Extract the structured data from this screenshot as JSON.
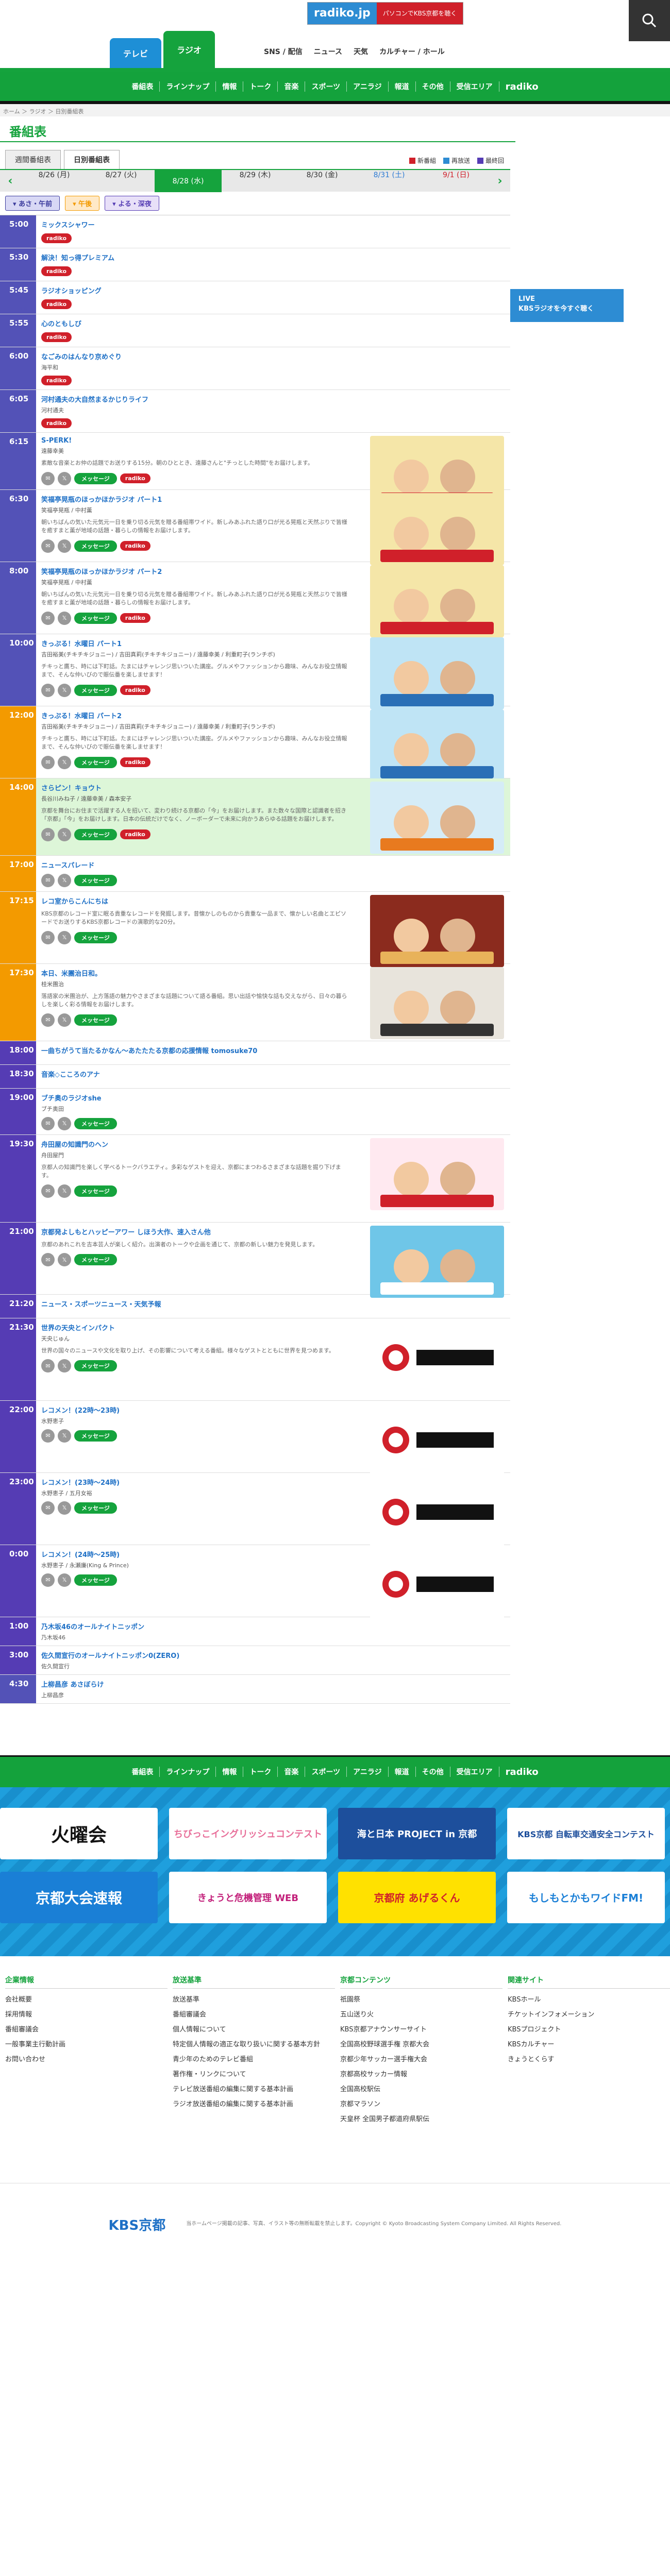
{
  "header": {
    "tab_tv": "テレビ",
    "tab_radio": "ラジオ",
    "radiko_logo": "radiko.jp",
    "radiko_text": "パソコンでKBS京都を聴く",
    "nav": [
      "SNS / 配信",
      "ニュース",
      "天気",
      "カルチャー / ホール"
    ],
    "subnav": [
      "番組表",
      "ラインナップ",
      "情報",
      "トーク",
      "音楽",
      "スポーツ",
      "アニラジ",
      "報道",
      "その他",
      "受信エリア",
      "radiko"
    ],
    "breadcrumb": "ホーム ＞ ラジオ ＞ 日別番組表",
    "title": "番組表"
  },
  "sidebar": {
    "live_label": "LIVE",
    "live_text": "KBSラジオを今すぐ聴く"
  },
  "views": {
    "weekly": "週間番組表",
    "daily": "日別番組表",
    "legend": [
      "新番組",
      "再放送",
      "最終回"
    ]
  },
  "dates": [
    "8/26 (月)",
    "8/27 (火)",
    "8/28 (水)",
    "8/29 (木)",
    "8/30 (金)",
    "8/31 (土)",
    "9/1 (日)"
  ],
  "periods": [
    "あさ・午前",
    "午後",
    "よる・深夜"
  ],
  "buttons": {
    "radiko": "radiko",
    "message": "メッセージ"
  },
  "programs": [
    {
      "time": "5:00",
      "title": "ミックスシャワー",
      "cast": "",
      "desc": ""
    },
    {
      "time": "5:30",
      "title": "解決！知っ得プレミアム",
      "cast": "",
      "desc": ""
    },
    {
      "time": "5:45",
      "title": "ラジオショッピング",
      "cast": "",
      "desc": ""
    },
    {
      "time": "5:55",
      "title": "心のともしび",
      "cast": "",
      "desc": ""
    },
    {
      "time": "6:00",
      "title": "なごみのはんなり京めぐり",
      "cast": "海平和",
      "desc": ""
    },
    {
      "time": "6:05",
      "title": "河村通夫の大自然まるかじりライフ",
      "cast": "河村通夫",
      "desc": ""
    },
    {
      "time": "6:15",
      "title": "S-PERK!",
      "cast": "遠藤幸美",
      "desc": "素敵な音楽とお仲の話題でお送りする15分。朝のひととき、遠藤さんと\"チっとした時間\"をお届けします。"
    },
    {
      "time": "6:30",
      "title": "笑福亭晃瓶のほっかほかラジオ パート1",
      "cast": "笑福亭晃瓶 / 中村薫",
      "desc": "朝いちばんの気いた元気元一日を乗り切る元気を贈る番組帯ワイド。新しみあふれた語り口が光る晃瓶と天然ぶりで皆様を癒すまと薫が地域の話題・暮らしの情報をお届けします。"
    },
    {
      "time": "8:00",
      "title": "笑福亭晃瓶のほっかほかラジオ パート2",
      "cast": "笑福亭晃瓶 / 中村薫",
      "desc": "朝いちばんの気いた元気元一日を乗り切る元気を贈る番組帯ワイド。新しみあふれた語り口が光る晃瓶と天然ぶりで皆様を癒すまと薫が地域の話題・暮らしの情報をお届けします。"
    },
    {
      "time": "10:00",
      "title": "きっぷる！水曜日 パート1",
      "cast": "吉田裕美(チキチキジョニー) / 吉田真莉(チキチキジョニー) / 遠藤幸美 / 利重町子(ランチボ)",
      "desc": "チキっと鷹ち、時には下町話。たまにはチャレンジ思いついた講座。グルメやファッションから趣味、みんなお役立情報まで、そんな仲いびので賑伝番を楽しませます！"
    },
    {
      "time": "12:00",
      "title": "きっぷる！水曜日 パート2",
      "cast": "吉田裕美(チキチキジョニー) / 吉田真莉(チキチキジョニー) / 遠藤幸美 / 利重町子(ランチボ)",
      "desc": "チキっと鷹ち、時には下町話。たまにはチャレンジ思いついた講座。グルメやファッションから趣味、みんなお役立情報まで、そんな仲いびので賑伝番を楽しませます！"
    },
    {
      "time": "14:00",
      "title": "さらピン！キョウト",
      "cast": "長谷川みね子 / 遠藤幸美 / 森本安子",
      "desc": "京都を舞台にお住まで活躍する人を招いて、変わり続ける京都の「今」をお届けします。また数々な国際と認識者を招き「京都」「今」をお届けします。日本の伝統だけでなく、ノーボーダーで未来に向かうあらゆる話題をお届けします。"
    },
    {
      "time": "17:00",
      "title": "ニュースパレード",
      "cast": "",
      "desc": ""
    },
    {
      "time": "17:15",
      "title": "レコ室からこんにちは",
      "cast": "",
      "desc": "KBS京都のレコード室に眠る貴重なレコードを発掘します。昔懐かしのものから貴重な一品まで、懐かしい名曲とエピソードでお送りするKBS京都レコードの演歌的な20分。"
    },
    {
      "time": "17:30",
      "title": "本日、米團治日和。",
      "cast": "桂米團治",
      "desc": "落語家の米團治が、上方落語の魅力やさまざまな話題について語る番組。思い出話や愉快な話も交えながら、日々の暮らしを楽しく彩る情報をお届けします。"
    },
    {
      "time": "18:00",
      "title": "一曲ちがうて当たるかなん〜あたたたる京都の応援情報 tomosuke70",
      "cast": "",
      "desc": ""
    },
    {
      "time": "18:30",
      "title": "音楽◇こころのアナ",
      "cast": "",
      "desc": ""
    },
    {
      "time": "19:00",
      "title": "ブチ奥のラジオshe",
      "cast": "ブチ奥田",
      "desc": ""
    },
    {
      "time": "19:30",
      "title": "舟田屋の知識門のヘン",
      "cast": "舟田屋門",
      "desc": "京都人の知識門を楽しく学べるトークバラエティ。多彩なゲストを迎え、京都にまつわるさまざまな話題を掘り下げます。"
    },
    {
      "time": "21:00",
      "title": "京都発よしもとハッピーアワー しほう大作、速入さん他",
      "cast": "",
      "desc": "京都のあれこれを吉本芸人が楽しく紹介。出演者のトークや企画を通じて、京都の新しい魅力を発見します。"
    },
    {
      "time": "21:20",
      "title": "ニュース・スポーツニュース・天気予報",
      "cast": "",
      "desc": ""
    },
    {
      "time": "21:30",
      "title": "世界の天央とインパクト",
      "cast": "天央じゅん",
      "desc": "世界の国々のニュースや文化を取り上げ、その影響について考える番組。様々なゲストとともに世界を見つめます。"
    },
    {
      "time": "22:00",
      "title": "レコメン！(22時〜23時)",
      "cast": "水野恵子",
      "desc": ""
    },
    {
      "time": "23:00",
      "title": "レコメン！(23時〜24時)",
      "cast": "水野恵子 / 五月女裕",
      "desc": ""
    },
    {
      "time": "0:00",
      "title": "レコメン！(24時〜25時)",
      "cast": "水野恵子 / 永瀬廉(King & Prince)",
      "desc": ""
    },
    {
      "time": "1:00",
      "title": "乃木坂46のオールナイトニッポン",
      "cast": "乃木坂46",
      "desc": ""
    },
    {
      "time": "3:00",
      "title": "佐久間宣行のオールナイトニッポン0(ZERO)",
      "cast": "佐久間宣行",
      "desc": ""
    },
    {
      "time": "4:30",
      "title": "上柳昌彦 あさぼらけ",
      "cast": "上柳昌彦",
      "desc": ""
    }
  ],
  "footer": {
    "subnav": [
      "番組表",
      "ラインナップ",
      "情報",
      "トーク",
      "音楽",
      "スポーツ",
      "アニラジ",
      "報道",
      "その他",
      "受信エリア",
      "radiko"
    ],
    "banners": [
      "火曜会",
      "ちびっこイングリッシュコンテスト",
      "海と日本 PROJECT in 京都",
      "KBS京都 自転車交通安全コンテスト",
      "京都大会速報",
      "きょうと危機管理 WEB",
      "京都府 あげるくん",
      "もしもとかもワイドFM!"
    ],
    "col1_title": "企業情報",
    "col1": [
      "会社概要",
      "採用情報",
      "番組審議会",
      "一般事業主行動計画",
      "お問い合わせ"
    ],
    "col2_title": "放送基準",
    "col2": [
      "放送基準",
      "番組審議会",
      "個人情報について",
      "特定個人情報の適正な取り扱いに関する基本方針",
      "青少年のためのテレビ番組",
      "著作権・リンクについて",
      "テレビ放送番組の編集に関する基本計画",
      "ラジオ放送番組の編集に関する基本計画"
    ],
    "col3_title": "京都コンテンツ",
    "col3": [
      "祇園祭",
      "五山送り火",
      "KBS京都アナウンサーサイト",
      "全国高校野球選手権 京都大会",
      "京都少年サッカー選手権大会",
      "京都高校サッカー情報",
      "全国高校駅伝",
      "京都マラソン",
      "天皇杯 全国男子都道府県駅伝"
    ],
    "col4_title": "関連サイト",
    "col4": [
      "KBSホール",
      "チケットインフォメーション",
      "KBSプロジェクト",
      "KBSカルチャー",
      "きょうとくらす"
    ],
    "logo": "KBS京都",
    "copyright": "当ホームページ掲載の記事、写真、イラスト等の無断転載を禁止します。Copyright © Kyoto Broadcasting System Company Limited. All Rights Reserved."
  },
  "colors": {
    "green": "#15a33d",
    "blue": "#1e70c6",
    "red": "#d0202a",
    "morning": "#5352b7",
    "day": "#f39a00",
    "night": "#553cb4"
  }
}
